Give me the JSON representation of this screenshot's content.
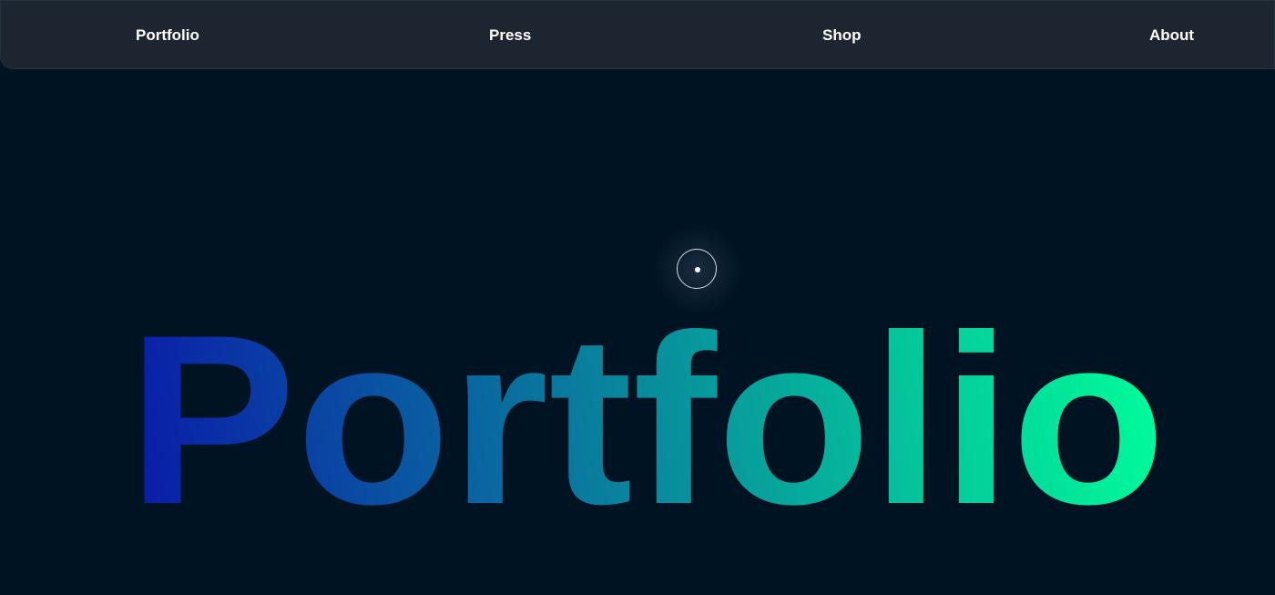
{
  "nav": {
    "items": [
      {
        "label": "Portfolio"
      },
      {
        "label": "Press"
      },
      {
        "label": "Shop"
      },
      {
        "label": "About"
      }
    ]
  },
  "hero": {
    "title": "Portfolio"
  },
  "colors": {
    "background": "#001322",
    "navbar": "#1d2630",
    "gradient_start": "#0a1aa8",
    "gradient_mid": "#0a7f9d",
    "gradient_end": "#00ff9a",
    "nav_text": "#ffffff"
  },
  "cursor": {
    "icon": "custom-cursor-icon"
  }
}
